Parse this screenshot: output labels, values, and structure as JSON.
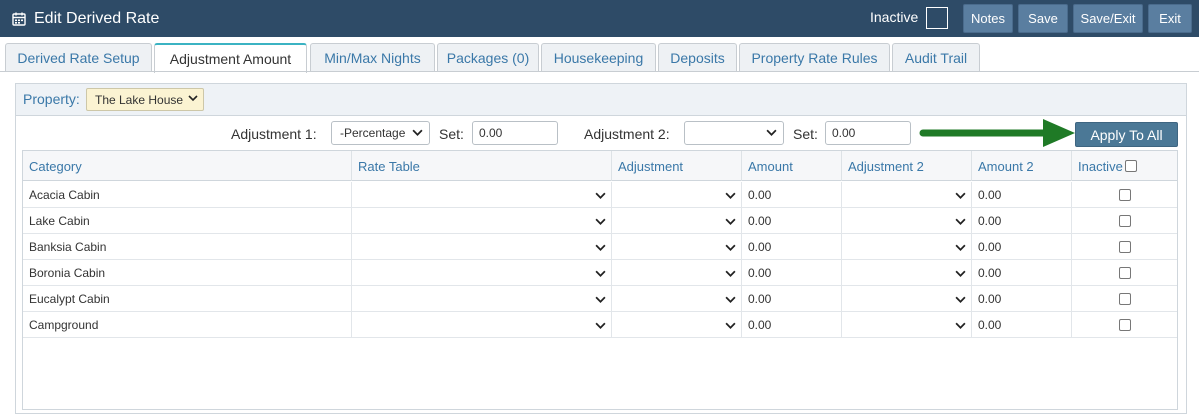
{
  "header": {
    "title": "Edit Derived Rate",
    "inactive_label": "Inactive",
    "buttons": {
      "notes": "Notes",
      "save": "Save",
      "save_exit": "Save/Exit",
      "exit": "Exit"
    },
    "inactive_checked": false
  },
  "tabs": [
    {
      "label": "Derived Rate Setup",
      "active": false
    },
    {
      "label": "Adjustment Amount",
      "active": true
    },
    {
      "label": "Min/Max Nights",
      "active": false
    },
    {
      "label": "Packages (0)",
      "active": false
    },
    {
      "label": "Housekeeping",
      "active": false
    },
    {
      "label": "Deposits",
      "active": false
    },
    {
      "label": "Property Rate Rules",
      "active": false
    },
    {
      "label": "Audit Trail",
      "active": false
    }
  ],
  "property": {
    "label": "Property:",
    "value": "The Lake House"
  },
  "adjustments": {
    "adj1_label": "Adjustment 1:",
    "adj1_value": "-Percentage",
    "set1_label": "Set:",
    "set1_value": "0.00",
    "adj2_label": "Adjustment 2:",
    "adj2_value": "",
    "set2_label": "Set:",
    "set2_value": "0.00",
    "apply_label": "Apply To All"
  },
  "table": {
    "columns": [
      "Category",
      "Rate Table",
      "Adjustment",
      "Amount",
      "Adjustment 2",
      "Amount 2",
      "Inactive"
    ],
    "rows": [
      {
        "category": "Acacia Cabin",
        "rate_table": "",
        "adjustment": "",
        "amount": "0.00",
        "adjustment2": "",
        "amount2": "0.00"
      },
      {
        "category": "Lake Cabin",
        "rate_table": "",
        "adjustment": "",
        "amount": "0.00",
        "adjustment2": "",
        "amount2": "0.00"
      },
      {
        "category": "Banksia Cabin",
        "rate_table": "",
        "adjustment": "",
        "amount": "0.00",
        "adjustment2": "",
        "amount2": "0.00"
      },
      {
        "category": "Boronia Cabin",
        "rate_table": "",
        "adjustment": "",
        "amount": "0.00",
        "adjustment2": "",
        "amount2": "0.00"
      },
      {
        "category": "Eucalypt Cabin",
        "rate_table": "",
        "adjustment": "",
        "amount": "0.00",
        "adjustment2": "",
        "amount2": "0.00"
      },
      {
        "category": "Campground",
        "rate_table": "",
        "adjustment": "",
        "amount": "0.00",
        "adjustment2": "",
        "amount2": "0.00"
      }
    ]
  },
  "colors": {
    "header_bg": "#2e4b67",
    "button_bg": "#5a7ea0",
    "apply_bg": "#4b7896",
    "arrow": "#1f7a26",
    "tab_active_accent": "#3bb3c3",
    "property_select_bg": "#fbf3d2"
  },
  "icons": {
    "title": "calendar-icon",
    "select": "chevron-down-icon",
    "annotation": "arrow-right-icon"
  }
}
